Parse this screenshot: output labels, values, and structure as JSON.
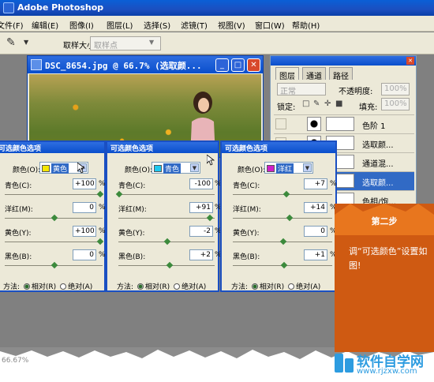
{
  "app": {
    "title": "Adobe Photoshop",
    "accent": "#0a4fcc"
  },
  "menu": [
    "文件(F)",
    "编辑(E)",
    "图像(I)",
    "图层(L)",
    "选择(S)",
    "滤镜(T)",
    "视图(V)",
    "窗口(W)",
    "帮助(H)"
  ],
  "options": {
    "sample_size_label": "取样大小:",
    "sample_size_value": "取样点"
  },
  "document": {
    "title": "DSC_8654.jpg @ 66.7% (选取颜..."
  },
  "layers_panel": {
    "tabs": [
      "图层",
      "通道",
      "路径"
    ],
    "blend_mode": "正常",
    "opacity_label": "不透明度:",
    "opacity_value": "100%",
    "lock_label": "锁定:",
    "fill_label": "填充:",
    "fill_value": "100%",
    "layers": [
      {
        "name": "色阶 1",
        "selected": false
      },
      {
        "name": "选取颜...",
        "selected": false
      },
      {
        "name": "通道混...",
        "selected": false
      },
      {
        "name": "选取颜...",
        "selected": true
      },
      {
        "name": "色相/饱...",
        "selected": false
      }
    ]
  },
  "dialogs": [
    {
      "title": "可选颜色选项",
      "color_label": "颜色(O):",
      "color": "黄色",
      "swatch": "#f5e600",
      "sliders": [
        {
          "label": "青色(C):",
          "value": "+100"
        },
        {
          "label": "洋红(M):",
          "value": "0"
        },
        {
          "label": "黄色(Y):",
          "value": "+100"
        },
        {
          "label": "黑色(B):",
          "value": "0"
        }
      ],
      "method_label": "方法:",
      "relative": "相对(R)",
      "absolute": "绝对(A)"
    },
    {
      "title": "可选颜色选项",
      "color_label": "颜色(O):",
      "color": "青色",
      "swatch": "#1ec8f0",
      "sliders": [
        {
          "label": "青色(C):",
          "value": "-100"
        },
        {
          "label": "洋红(M):",
          "value": "+91"
        },
        {
          "label": "黄色(Y):",
          "value": "-2"
        },
        {
          "label": "黑色(B):",
          "value": "+2"
        }
      ],
      "method_label": "方法:",
      "relative": "相对(R)",
      "absolute": "绝对(A)"
    },
    {
      "title": "可选颜色选项",
      "color_label": "颜色(O):",
      "color": "洋红",
      "swatch": "#d020c8",
      "sliders": [
        {
          "label": "青色(C):",
          "value": "+7"
        },
        {
          "label": "洋红(M):",
          "value": "+14"
        },
        {
          "label": "黄色(Y):",
          "value": "0"
        },
        {
          "label": "黑色(B):",
          "value": "+1"
        }
      ],
      "method_label": "方法:",
      "relative": "相对(R)",
      "absolute": "绝对(A)"
    }
  ],
  "note": {
    "step": "第二步",
    "text": "调“可选颜色”设置如图!",
    "color": "#cf5a12"
  },
  "status": {
    "zoom": "66.67%"
  },
  "watermark": {
    "name": "软件自学网",
    "url": "www.rjzxw.com"
  }
}
